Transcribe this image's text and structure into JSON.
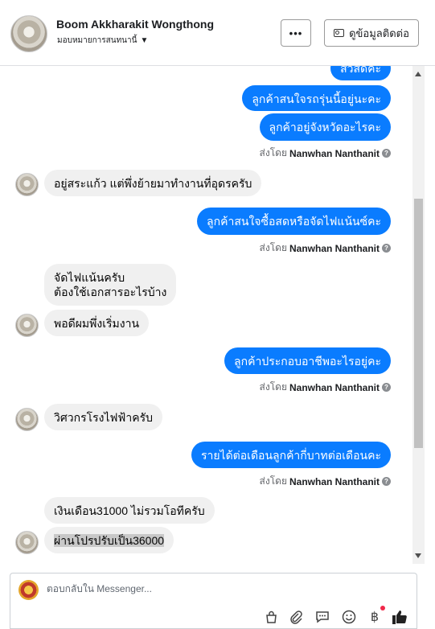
{
  "header": {
    "contact_name": "Boom Akkharakit Wongthong",
    "assign_label": "มอบหมายการสนทนานี้",
    "more_label": "•••",
    "view_contact_label": "ดูข้อมูลติดต่อ"
  },
  "messages": {
    "m1": "สวัสดีค่ะ",
    "m2": "ลูกค้าสนใจรถรุ่นนี้อยู่นะคะ",
    "m3": "ลูกค้าอยู่จังหวัดอะไรคะ",
    "sent_by_1_prefix": "ส่งโดย",
    "sent_by_1_name": "Nanwhan Nanthanit",
    "m4": "อยู่สระแก้ว แต่พึ่งย้ายมาทำงานที่อุดรครับ",
    "m5": "ลูกค้าสนใจซื้อสดหรือจัดไฟแน้นซ์คะ",
    "sent_by_2_prefix": "ส่งโดย",
    "sent_by_2_name": "Nanwhan Nanthanit",
    "m6_line1": "จัดไฟแน้นครับ",
    "m6_line2": "ต้องใช้เอกสารอะไรบ้าง",
    "m7": "พอดีผมพึ่งเริ่มงาน",
    "m8": "ลูกค้าประกอบอาชีพอะไรอยู่คะ",
    "sent_by_3_prefix": "ส่งโดย",
    "sent_by_3_name": "Nanwhan Nanthanit",
    "m9": "วิศวกรโรงไฟฟ้าครับ",
    "m10": "รายได้ต่อเดือนลูกค้ากี่บาทต่อเดือนคะ",
    "sent_by_4_prefix": "ส่งโดย",
    "sent_by_4_name": "Nanwhan Nanthanit",
    "m11": "เงินเดือน31000 ไม่รวมโอทีครับ",
    "m12": "ผ่านโปรปรับเป็น36000"
  },
  "composer": {
    "placeholder": "ตอบกลับใน Messenger..."
  },
  "colors": {
    "outgoing_bubble": "#0a7cff",
    "incoming_bubble": "#f0f0f0",
    "notification_dot": "#f02849"
  },
  "icons": [
    "bag-icon",
    "attachment-icon",
    "saved-reply-icon",
    "emoji-icon",
    "baht-payment-icon",
    "thumbs-up-icon",
    "help-icon",
    "chevron-down-icon",
    "contact-card-icon"
  ]
}
